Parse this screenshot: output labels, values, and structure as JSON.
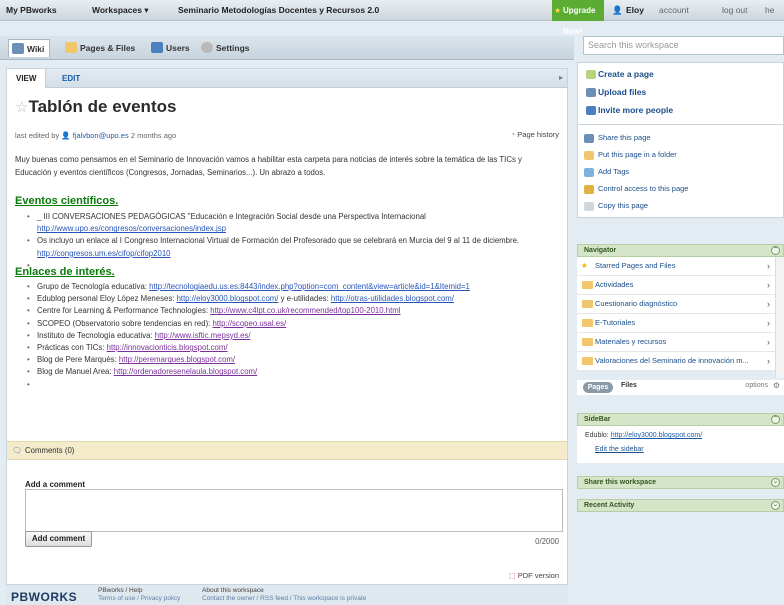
{
  "topbar": {
    "my_pbworks": "My PBworks",
    "workspaces": "Workspaces ▾",
    "workspace_name": "Seminario Metodologías Docentes y Recursos 2.0",
    "upgrade": "Upgrade Now!",
    "user": "Eloy",
    "account": "account",
    "logout": "log out",
    "help": "he"
  },
  "tabs": [
    {
      "label": "Wiki"
    },
    {
      "label": "Pages & Files"
    },
    {
      "label": "Users"
    },
    {
      "label": "Settings"
    }
  ],
  "search": {
    "placeholder": "Search this workspace"
  },
  "subtabs": {
    "view": "VIEW",
    "edit": "EDIT"
  },
  "page": {
    "title": "Tablón de eventos",
    "meta_prefix": "last edited by",
    "meta_user": "fjalvbon@upo.es",
    "meta_time": "2 months ago",
    "history": "Page history",
    "intro": "Muy buenas como pensamos en el Seminario de Innovación vamos a habilitar esta carpeta para noticias de interés sobre la temática de las TICs y Educación y eventos científicos (Congresos, Jornadas, Seminarios...). Un abrazo a todos.",
    "h_events": "Eventos científicos.",
    "events": [
      {
        "text": "_ III CONVERSACIONES PEDAGÓGICAS \"Educación e Integración Social desde una Perspectiva Internacional",
        "link": "http://www.upo.es/congresos/conversaciones/index.jsp"
      },
      {
        "text": "Os incluyo un enlace al I Congreso Internacional Virtual de Formación del Profesorado que se celebrará en Murcia del 9 al 11 de diciembre.",
        "link": "http://congresos.um.es/cifop/cifop2010"
      }
    ],
    "h_links": "Enlaces de interés.",
    "links": [
      {
        "text": "Grupo de Tecnología educativa:",
        "link": "http://tecnologiaedu.us.es:8443/index.php?option=com_content&view=article&id=1&Itemid=1",
        "after": ""
      },
      {
        "text": "Edublog personal Eloy López Meneses:",
        "link": "http://eloy3000.blogspot.com/",
        "after": "y e-utilidades:",
        "link2": "http://otras-utilidades.blogspot.com/"
      },
      {
        "text": "Centre for Learning & Performance Technologies:",
        "link": "http://www.c4lpt.co.uk/recommended/top100-2010.html",
        "after": ""
      },
      {
        "text": "SCOPEO (Observatorio sobre tendencias en red):",
        "link": "http://scopeo.usal.es/",
        "after": ""
      },
      {
        "text": "Instituto de Tecnología educativa:",
        "link": "http://www.isftic.mepsyd.es/",
        "after": ""
      },
      {
        "text": "Prácticas con TICs:",
        "link": "http://innovacionticis.blogspot.com/",
        "after": ""
      },
      {
        "text": "Blog de Pere Marquès:",
        "link": "http://peremarques.blogspot.com/",
        "after": ""
      },
      {
        "text": "Blog de Manuel Area:",
        "link": "http://ordenadoresenelaula.blogspot.com/",
        "after": ""
      }
    ]
  },
  "comments": {
    "label": "Comments (0)",
    "add_label": "Add a comment",
    "counter": "0/2000",
    "button": "Add comment",
    "pdf": "PDF version"
  },
  "footer": {
    "logo": "PBWORKS",
    "col1": "PBworks / Help",
    "col1b": "Terms of use / Privacy policy",
    "col2": "About this workspace",
    "col2b": "Contact the owner / RSS feed / This workspace is private"
  },
  "actions": {
    "create": "Create a page",
    "upload": "Upload files",
    "invite": "Invite more people",
    "share": "Share this page",
    "folder": "Put this page in a folder",
    "tags": "Add Tags",
    "access": "Control access to this page",
    "copy": "Copy this page"
  },
  "navigator": {
    "title": "Navigator",
    "items": [
      "Starred Pages and Files",
      "Actividades",
      "Cuestionario diagnóstico",
      "E-Tutoriales",
      "Materiales y recursos",
      "Valoraciones del Seminario de innovación m..."
    ],
    "pages": "Pages",
    "files": "Files",
    "options": "options"
  },
  "sidebar": {
    "title": "SideBar",
    "text": "Edublo:",
    "link": "http://eloy3000.blogspot.com/",
    "edit": "Edit the sidebar"
  },
  "share_ws": {
    "title": "Share this workspace"
  },
  "recent": {
    "title": "Recent Activity"
  },
  "colors": {
    "green": "#5aad32",
    "heading_green": "#0a7a0a",
    "link": "#2855b7"
  }
}
